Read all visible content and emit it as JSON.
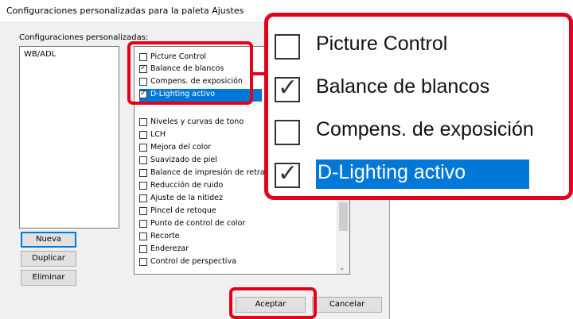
{
  "dialog": {
    "title": "Configuraciones personalizadas para la paleta Ajustes",
    "left_label": "Configuraciones personalizadas:",
    "left_items": [
      "WB/ADL"
    ],
    "buttons": {
      "new": "Nueva",
      "duplicate": "Duplicar",
      "delete": "Eliminar"
    },
    "ok": "Aceptar",
    "cancel": "Cancelar"
  },
  "checklist": {
    "items": [
      {
        "label": "Picture Control",
        "checked": false
      },
      {
        "label": "Balance de blancos",
        "checked": true
      },
      {
        "label": "Compens. de exposición",
        "checked": false
      },
      {
        "label": "D-Lighting activo",
        "checked": true,
        "selected": true
      },
      {
        "label": "Niveles y curvas de tono",
        "checked": false
      },
      {
        "label": "LCH",
        "checked": false
      },
      {
        "label": "Mejora del color",
        "checked": false
      },
      {
        "label": "Suavizado de piel",
        "checked": false
      },
      {
        "label": "Balance de impresión de retrato",
        "checked": false
      },
      {
        "label": "Reducción de ruido",
        "checked": false
      },
      {
        "label": "Ajuste de la nitidez",
        "checked": false
      },
      {
        "label": "Pincel de retoque",
        "checked": false
      },
      {
        "label": "Punto de control de color",
        "checked": false
      },
      {
        "label": "Recorte",
        "checked": false
      },
      {
        "label": "Enderezar",
        "checked": false
      },
      {
        "label": "Control de perspectiva",
        "checked": false
      }
    ]
  },
  "zoom": {
    "items": [
      {
        "label": "Picture Control",
        "checked": false
      },
      {
        "label": "Balance de blancos",
        "checked": true
      },
      {
        "label": "Compens. de exposición",
        "checked": false
      },
      {
        "label": "D-Lighting activo",
        "checked": true,
        "selected": true
      }
    ]
  },
  "colors": {
    "highlight": "#e3001b",
    "selection": "#0078d7"
  }
}
